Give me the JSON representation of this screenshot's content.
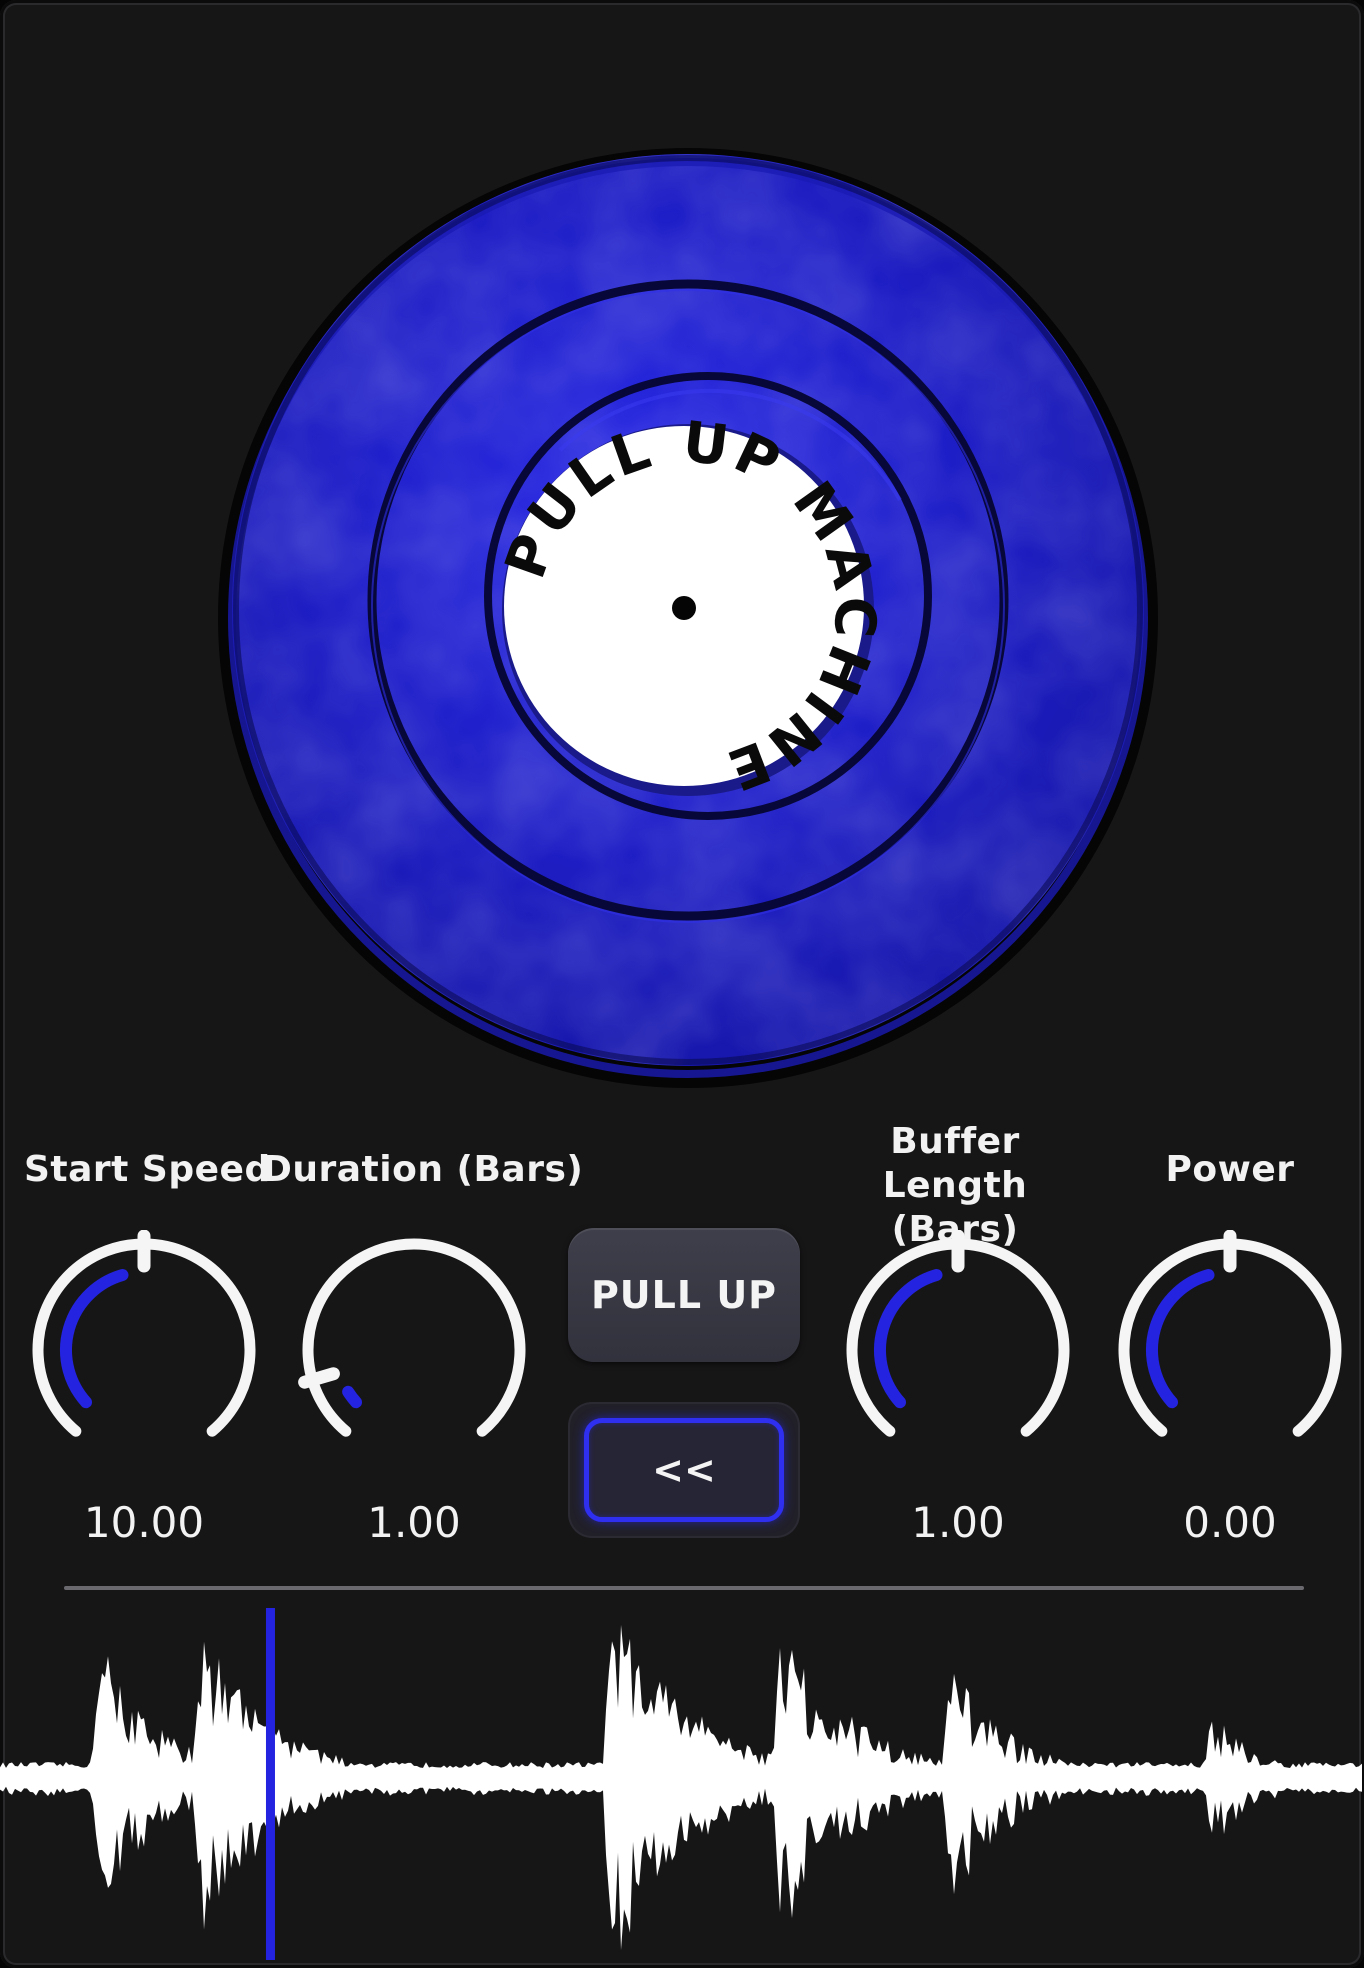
{
  "app": {
    "label_text": "PULL UP MACHINE"
  },
  "knobs": [
    {
      "label": "Start Speed",
      "value": "10.00",
      "fraction": 0.5
    },
    {
      "label": "Duration (Bars)",
      "value": "1.00",
      "fraction": 0.12
    },
    {
      "label": "Buffer Length (Bars)",
      "value": "1.00",
      "fraction": 0.5
    },
    {
      "label": "Power",
      "value": "0.00",
      "fraction": 0.5
    }
  ],
  "buttons": {
    "pull_up": "PULL UP",
    "rewind": "<<"
  },
  "colors": {
    "accent": "#2424e0",
    "vinyl": "#1f1fc8",
    "background": "#171617"
  },
  "waveform": {
    "playhead_position": 0.195
  }
}
